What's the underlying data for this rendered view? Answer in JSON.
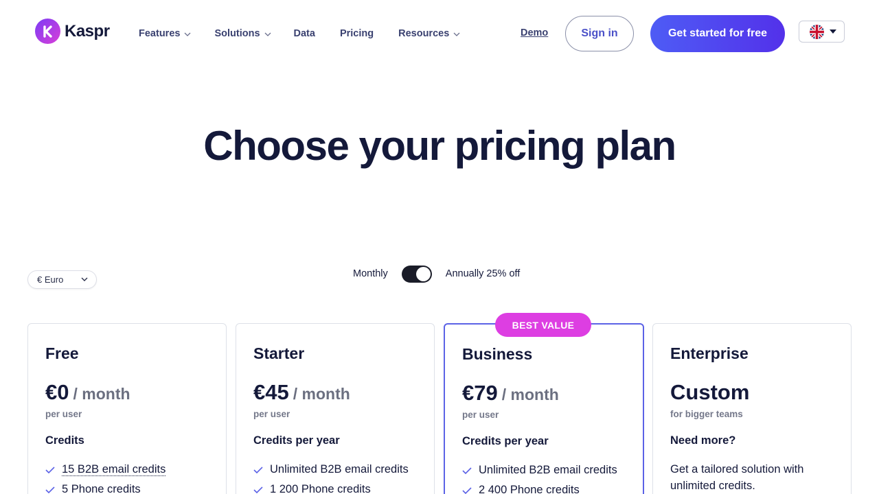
{
  "header": {
    "logo_text": "Kaspr",
    "nav": [
      {
        "label": "Features",
        "has_dropdown": true
      },
      {
        "label": "Solutions",
        "has_dropdown": true
      },
      {
        "label": "Data",
        "has_dropdown": false
      },
      {
        "label": "Pricing",
        "has_dropdown": false
      },
      {
        "label": "Resources",
        "has_dropdown": true
      }
    ],
    "demo_label": "Demo",
    "signin_label": "Sign in",
    "cta_label": "Get started for free",
    "language_icon": "uk-flag-icon"
  },
  "hero": {
    "title": "Choose your pricing plan"
  },
  "controls": {
    "currency": "€ Euro",
    "billing_monthly": "Monthly",
    "billing_annual": "Annually 25% off",
    "annual_selected": true
  },
  "plans": [
    {
      "name": "Free",
      "price": "€0",
      "price_unit": "/ month",
      "price_note": "per user",
      "section_title": "Credits",
      "features": [
        "15 B2B email credits",
        "5 Phone credits"
      ]
    },
    {
      "name": "Starter",
      "price": "€45",
      "price_unit": "/ month",
      "price_note": "per user",
      "section_title": "Credits per year",
      "features": [
        "Unlimited B2B email credits",
        "1 200 Phone credits"
      ]
    },
    {
      "name": "Business",
      "badge": "BEST VALUE",
      "price": "€79",
      "price_unit": "/ month",
      "price_note": "per user",
      "section_title": "Credits per year",
      "features": [
        "Unlimited B2B email credits",
        "2 400 Phone credits"
      ]
    },
    {
      "name": "Enterprise",
      "price": "Custom",
      "price_note": "for bigger teams",
      "section_title": "Need more?",
      "description": "Get a tailored solution with unlimited credits."
    }
  ],
  "colors": {
    "brand_primary": "#5331ea",
    "badge": "#dd3ee2",
    "text_dark": "#14193a",
    "featured_border": "#5b62e6"
  }
}
